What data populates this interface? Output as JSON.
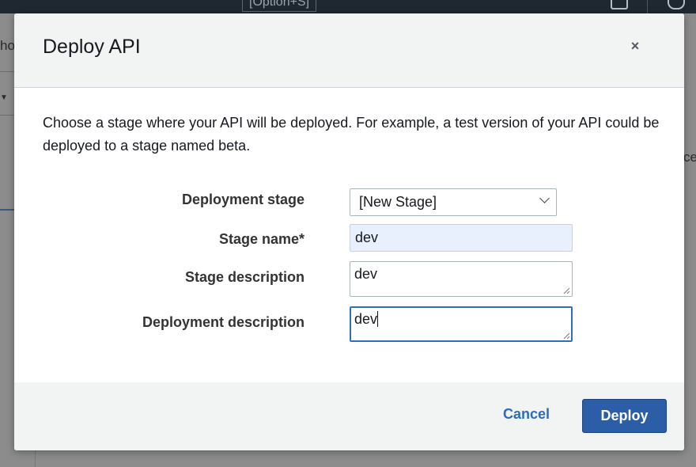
{
  "background": {
    "shortcut_hint": "[Option+S]",
    "left_fragment": "ho",
    "right_fragment": "ce"
  },
  "dialog": {
    "title": "Deploy API",
    "close_label": "×",
    "intro": "Choose a stage where your API will be deployed. For example, a test version of your API could be deployed to a stage named beta.",
    "fields": {
      "deployment_stage": {
        "label": "Deployment stage",
        "value": "[New Stage]"
      },
      "stage_name": {
        "label": "Stage name*",
        "value": "dev"
      },
      "stage_description": {
        "label": "Stage description",
        "value": "dev"
      },
      "deployment_description": {
        "label": "Deployment description",
        "value": "dev"
      }
    },
    "buttons": {
      "cancel": "Cancel",
      "deploy": "Deploy"
    }
  },
  "colors": {
    "primary_button": "#2c5ea8",
    "link": "#2a6dbc",
    "autofill_bg": "#e8f0fe",
    "focus_border": "#2f6fba"
  }
}
